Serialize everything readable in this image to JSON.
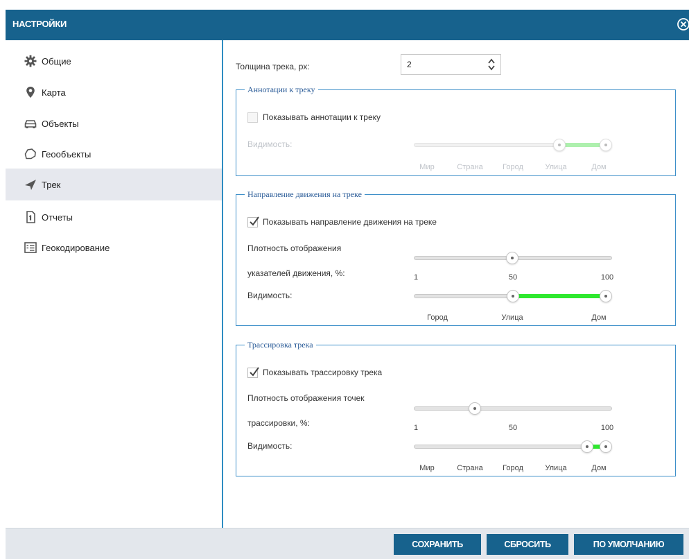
{
  "dialog": {
    "title": "НАСТРОЙКИ",
    "close_icon": "close-circle-icon"
  },
  "sidebar": {
    "items": [
      {
        "label": "Общие",
        "icon": "gear-icon"
      },
      {
        "label": "Карта",
        "icon": "map-pin-icon"
      },
      {
        "label": "Объекты",
        "icon": "car-icon"
      },
      {
        "label": "Геообъекты",
        "icon": "polygon-icon"
      },
      {
        "label": "Трек",
        "icon": "paper-plane-icon",
        "active": true
      },
      {
        "label": "Отчеты",
        "icon": "document-icon"
      },
      {
        "label": "Геокодирование",
        "icon": "list-card-icon"
      }
    ]
  },
  "track": {
    "thickness_label": "Толщина трека, px:",
    "thickness_value": "2"
  },
  "annotations": {
    "legend": "Аннотации к треку",
    "checkbox_label": "Показывать аннотации к треку",
    "checked": false,
    "visibility_label": "Видимость:",
    "scale": [
      "Мир",
      "Страна",
      "Город",
      "Улица",
      "Дом"
    ],
    "range_from_index": 3,
    "range_to_index": 4
  },
  "direction": {
    "legend": "Направление движения на треке",
    "checkbox_label": "Показывать направление движения на треке",
    "checked": true,
    "density_label_line1": "Плотность отображения",
    "density_label_line2": "указателей движения, %:",
    "density_ticks": [
      "1",
      "50",
      "100"
    ],
    "density_value": 50,
    "visibility_label": "Видимость:",
    "scale": [
      "Город",
      "Улица",
      "Дом"
    ],
    "range_from_index": 1,
    "range_to_index": 2
  },
  "tracing": {
    "legend": "Трассировка трека",
    "checkbox_label": "Показывать трассировку трека",
    "checked": true,
    "density_label_line1": "Плотность отображения точек",
    "density_label_line2": "трассировки, %:",
    "density_ticks": [
      "1",
      "50",
      "100"
    ],
    "density_value": 30,
    "visibility_label": "Видимость:",
    "scale": [
      "Мир",
      "Страна",
      "Город",
      "Улица",
      "Дом"
    ],
    "range_from_index": 3.6,
    "range_to_index": 4
  },
  "footer": {
    "save_label": "СОХРАНИТЬ",
    "reset_label": "СБРОСИТЬ",
    "default_label": "ПО УМОЛЧАНИЮ"
  },
  "colors": {
    "header": "#17628d",
    "accent_border": "#2e8cc2",
    "slider_fill": "#2ee82e",
    "active_item_bg": "#e6e8ee",
    "footer_bg": "#e3e7ec"
  }
}
